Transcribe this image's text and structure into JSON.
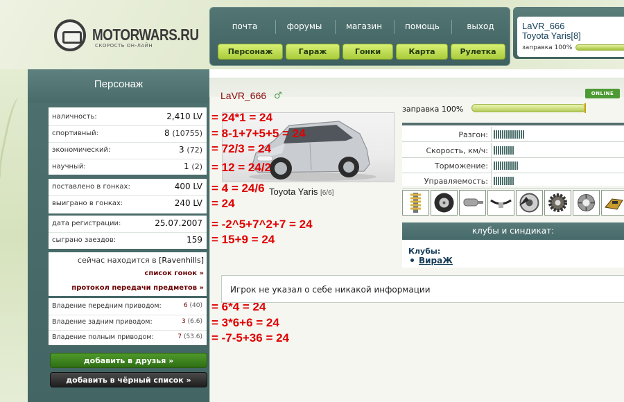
{
  "site": {
    "logo_text": "MOTORWARS.RU",
    "tagline": "СКОРОСТЬ ОН-ЛАЙН"
  },
  "nav": {
    "top": [
      "почта",
      "форумы",
      "магазин",
      "помощь",
      "выход"
    ],
    "buttons": [
      "Персонаж",
      "Гараж",
      "Гонки",
      "Карта",
      "Рулетка"
    ]
  },
  "user": {
    "name": "LaVR_666",
    "car": "Toyota Yaris[8]",
    "fuel_label": "заправка 100%",
    "fuel_level": 1.0
  },
  "page": {
    "title": "Персонаж"
  },
  "stats": {
    "g1": [
      {
        "label": "наличность:",
        "value": "2,410 LV",
        "sub": ""
      },
      {
        "label": "спортивный:",
        "value": "8",
        "sub": "(10755)"
      },
      {
        "label": "экономический:",
        "value": "3",
        "sub": "(72)"
      },
      {
        "label": "научный:",
        "value": "1",
        "sub": "(2)"
      }
    ],
    "g2": [
      {
        "label": "поставлено в гонках:",
        "value": "400 LV"
      },
      {
        "label": "выиграно в гонках:",
        "value": "240 LV"
      }
    ],
    "g3": [
      {
        "label": "дата регистрации:",
        "value": "25.07.2007"
      },
      {
        "label": "сыграно заездов:",
        "value": "159"
      }
    ],
    "location_prefix": "сейчас находится в",
    "location": "[Ravenhills]",
    "race_list_link": "список гонок »",
    "transfer_log_link": "протокол передачи предметов »",
    "drives": [
      {
        "label": "Владение передним приводом:",
        "value": "6",
        "sub": "(40)"
      },
      {
        "label": "Владение задним приводом:",
        "value": "3",
        "sub": "(6.6)"
      },
      {
        "label": "Владение полным приводом:",
        "value": "7",
        "sub": "(53.6)"
      }
    ],
    "add_friend": "добавить в друзья »",
    "add_blacklist": "добавить в чёрный список »"
  },
  "annotations": [
    "= 24*1 = 24",
    "= 8-1+7+5+5 = 24",
    "= 72/3 = 24",
    "= 12 = 24/2",
    "= 4 = 24/6",
    "= 24",
    "= -2^5+7^2+7 = 24",
    "= 15+9 = 24",
    "= 6*4 = 24",
    "= 3*6+6 = 24",
    "= -7-5+36 = 24"
  ],
  "profile": {
    "name": "LaVR_666",
    "online_badge": "ONLINE",
    "car_name": "Toyota Yaris",
    "car_slots": "[6/6]",
    "fuel_label": "заправка 100%",
    "fuel_level": 1.0,
    "car_stats": [
      {
        "label": "Разгон:",
        "ticks": 15
      },
      {
        "label": "Скорость, км/ч:",
        "ticks": 10
      },
      {
        "label": "Торможение:",
        "ticks": 12
      },
      {
        "label": "Управляемость:",
        "ticks": 10
      }
    ],
    "parts": [
      "suspension-icon",
      "tire-icon",
      "exhaust-icon",
      "seatbelt-icon",
      "brake-disc-icon",
      "gear-icon",
      "turbo-icon",
      "battery-icon"
    ],
    "clubs_header": "клубы и синдикат:",
    "clubs_label": "Клубы:",
    "clubs": [
      "ВираЖ"
    ],
    "info": "Игрок не указал о себе никакой информации"
  },
  "colors": {
    "accent_green": "#a8cc3a",
    "teal_panel": "#4e706e",
    "annotation_red": "#e00000",
    "name_red": "#8b0a0a"
  }
}
